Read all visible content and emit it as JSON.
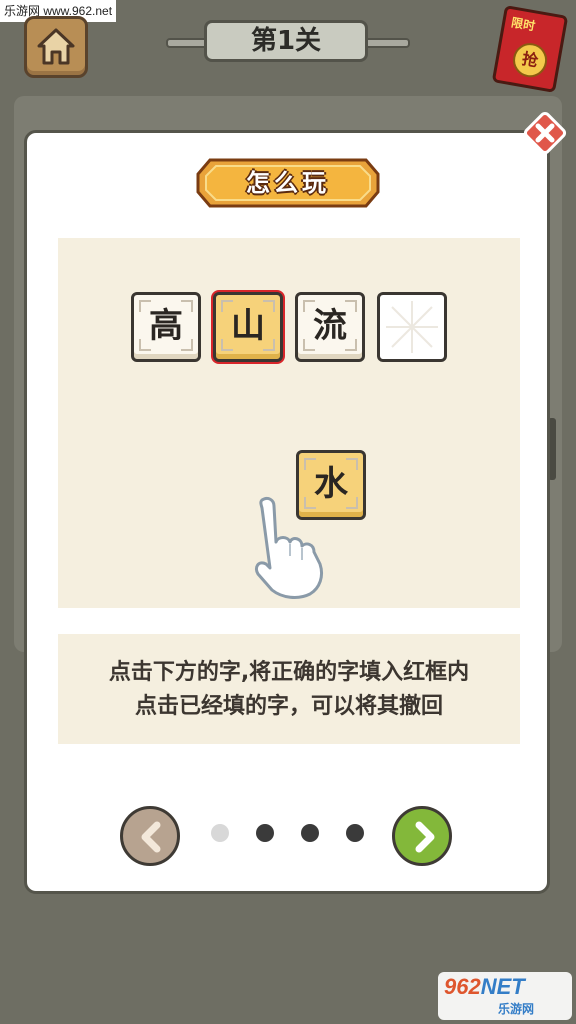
{
  "watermark_top": "乐游网 www.962.net",
  "header": {
    "level_title": "第1关",
    "redpacket_tag": "限时",
    "redpacket_coin": "抢"
  },
  "modal": {
    "title": "怎么玩",
    "demo": {
      "tiles": [
        "高",
        "山",
        "流",
        ""
      ],
      "candidate": "水"
    },
    "description": [
      "点击下方的字,将正确的字填入红框内",
      "点击已经填的字，可以将其撤回"
    ],
    "pagination": {
      "total": 4,
      "current": 1
    }
  },
  "watermark_bottom": {
    "brand_a": "962",
    "brand_b": "NET",
    "site": "乐游网"
  },
  "colors": {
    "background": "#6e6e63",
    "selected_border": "#d8262a",
    "tile_gold": "#f6d27a",
    "next_green": "#83b83a",
    "prev_brown": "#b7a390"
  },
  "icons": [
    "home-icon",
    "close-icon",
    "chevron-left-icon",
    "chevron-right-icon",
    "pointing-hand-icon"
  ]
}
